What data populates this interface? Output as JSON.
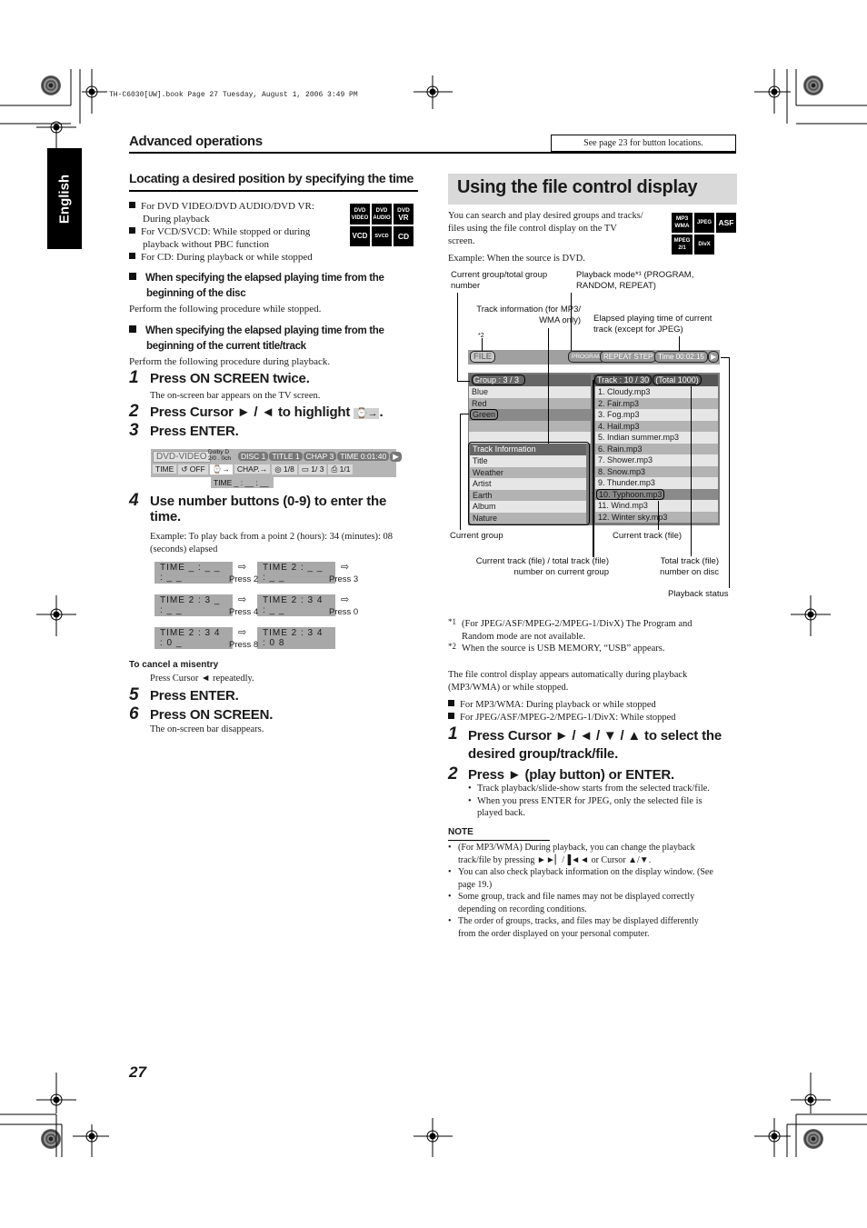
{
  "print_header": "TH-C6030[UW].book  Page 27  Tuesday, August 1, 2006  3:49 PM",
  "side_tab": "English",
  "section_title": "Advanced operations",
  "see_page_note": "See page 23 for button locations.",
  "left": {
    "heading": "Locating a desired position by specifying the time",
    "conditions": [
      {
        "line1": "For DVD VIDEO/DVD AUDIO/DVD VR:",
        "line2": "During playback"
      },
      {
        "line1": "For VCD/SVCD: While stopped or during",
        "line2": "playback without PBC function"
      },
      {
        "line1": "For CD: During playback or while stopped",
        "line2": ""
      }
    ],
    "media_badges": [
      {
        "top": "DVD",
        "bottom": "VIDEO"
      },
      {
        "top": "DVD",
        "bottom": "AUDIO"
      },
      {
        "top": "DVD",
        "bottom": "VR"
      },
      {
        "top": "VCD",
        "bottom": ""
      },
      {
        "top": "SVCD",
        "bottom": ""
      },
      {
        "top": "CD",
        "bottom": ""
      }
    ],
    "sub1": {
      "line1": "When specifying the elapsed playing time from the",
      "line2": "beginning of the disc",
      "text": "Perform the following procedure while stopped."
    },
    "sub2": {
      "line1": "When specifying the elapsed playing time from the",
      "line2": "beginning of the current title/track",
      "text": "Perform the following procedure during playback."
    },
    "steps": [
      {
        "num": "1",
        "text": "Press ON SCREEN twice.",
        "note": "The on-screen bar appears on the TV screen."
      },
      {
        "num": "2",
        "text": "Press Cursor ► / ◄ to highlight",
        "icon": "⌚→",
        "end": "."
      },
      {
        "num": "3",
        "text": "Press ENTER."
      },
      {
        "num": "4",
        "text": "Use number buttons (0-9) to enter the",
        "text2": "time.",
        "note": "Example: To play back from a point 2 (hours): 34 (minutes): 08",
        "note2": "(seconds) elapsed"
      },
      {
        "num": "5",
        "text": "Press ENTER."
      },
      {
        "num": "6",
        "text": "Press ON SCREEN.",
        "note": "The on-screen bar disappears."
      }
    ],
    "osd": {
      "source": "DVD-VIDEO",
      "audio_line1": "Dolby D",
      "audio_line2": "2/0 . 0ch",
      "disc": "DISC 1",
      "title": "TITLE  1",
      "chap": "CHAP  3",
      "time": "TIME   0:01:40",
      "row2": [
        "TIME",
        "↺ OFF",
        "⌚→",
        "CHAP.→",
        "◎ 1/8",
        "▭ 1/ 3",
        "⎙ 1/1"
      ],
      "time_entry": "TIME   _ : __ : __"
    },
    "time_sequence": [
      {
        "value": "TIME  _ : _ _ : _ _",
        "press": ""
      },
      {
        "value": "TIME  2 : _ _ : _ _",
        "press": "Press 2"
      },
      {
        "value": "TIME  2 : 3 _ : _ _",
        "press": "Press 3"
      },
      {
        "value": "TIME  2 : 3 4 : _ _",
        "press": "Press 4"
      },
      {
        "value": "TIME  2 : 3 4 : 0 _",
        "press": "Press 0"
      },
      {
        "value": "TIME  2 : 3 4 : 0 8",
        "press": "Press 8"
      }
    ],
    "cancel_heading": "To cancel a misentry",
    "cancel_text": "Press Cursor ◄ repeatedly."
  },
  "right": {
    "heading": "Using the file control display",
    "intro": [
      "You can search and play desired groups and tracks/",
      "files using the file control display on the TV",
      "screen."
    ],
    "media_badges": [
      {
        "top": "MP3",
        "bottom": "WMA"
      },
      {
        "top": "JPEG",
        "bottom": ""
      },
      {
        "top": "ASF",
        "bottom": ""
      },
      {
        "top": "MPEG",
        "bottom": "2/1"
      },
      {
        "top": "DivX",
        "bottom": ""
      }
    ],
    "example": "Example: When the source is DVD.",
    "callouts": {
      "group_number": [
        "Current group/total group",
        "number"
      ],
      "playback_mode": [
        "Playback mode*¹ (PROGRAM,",
        "RANDOM, REPEAT)"
      ],
      "track_info": [
        "Track information (for MP3/",
        "WMA only)"
      ],
      "elapsed": [
        "Elapsed playing time of current",
        "track (except for JPEG)"
      ],
      "star2": "*2",
      "current_group": "Current group",
      "current_track": "Current track (file)",
      "track_total_group": [
        "Current track (file) / total track (file)",
        "number on current group"
      ],
      "total_disc": [
        "Total track (file)",
        "number on disc"
      ],
      "playback_status": "Playback status"
    },
    "display": {
      "file_label": "FILE",
      "program": "PROGRAM",
      "repeat": "REPEAT STEP",
      "time": "Time 00:02:15",
      "status_icon": "▶",
      "group_header": "Group :   3 / 3",
      "groups": [
        "Blue",
        "Red",
        "Green",
        "",
        ""
      ],
      "current_group_index": 2,
      "track_info_header": "Track  Information",
      "track_info": [
        "Title",
        "Weather",
        "Artist",
        "Earth",
        "Album",
        "Nature"
      ],
      "track_header": "Track  :  10  /  30",
      "total": "(Total  1000)",
      "tracks": [
        "1. Cloudy.mp3",
        "2. Fair.mp3",
        "3. Fog.mp3",
        "4. Hail.mp3",
        "5. Indian summer.mp3",
        "6. Rain.mp3",
        "7. Shower.mp3",
        "8. Snow.mp3",
        "9. Thunder.mp3",
        "10. Typhoon.mp3",
        "11. Wind.mp3",
        "12. Winter sky.mp3"
      ],
      "current_track_index": 9
    },
    "footnotes": [
      {
        "mark": "*1",
        "lines": [
          "(For JPEG/ASF/MPEG-2/MPEG-1/DivX) The Program and",
          "Random mode are not available."
        ]
      },
      {
        "mark": "*2",
        "lines": [
          "When the source is USB MEMORY, “USB” appears."
        ]
      }
    ],
    "auto_text": [
      "The file control display appears automatically during playback",
      "(MP3/WMA) or while stopped."
    ],
    "conditions": [
      "For MP3/WMA: During playback or while stopped",
      "For JPEG/ASF/MPEG-2/MPEG-1/DivX: While stopped"
    ],
    "steps": [
      {
        "num": "1",
        "line1": "Press Cursor ► / ◄ / ▼ / ▲ to select the",
        "line2": "desired group/track/file."
      },
      {
        "num": "2",
        "line1": "Press ► (play button) or ENTER.",
        "bullets": [
          "Track playback/slide-show starts from the selected track/file.",
          "When you press ENTER for JPEG, only the selected file is",
          "played back."
        ]
      }
    ],
    "note_heading": "NOTE",
    "notes": [
      [
        "(For MP3/WMA) During playback, you can change the playback",
        "track/file by pressing ►►▏/▐◄◄ or Cursor ▲/▼."
      ],
      [
        "You can also check playback information on the display window. (See",
        "page 19.)"
      ],
      [
        "Some group, track and file names may not be displayed correctly",
        "depending on recording conditions."
      ],
      [
        "The order of groups, tracks, and files may be displayed differently",
        "from the order displayed on your personal computer."
      ]
    ]
  },
  "page_number": "27"
}
